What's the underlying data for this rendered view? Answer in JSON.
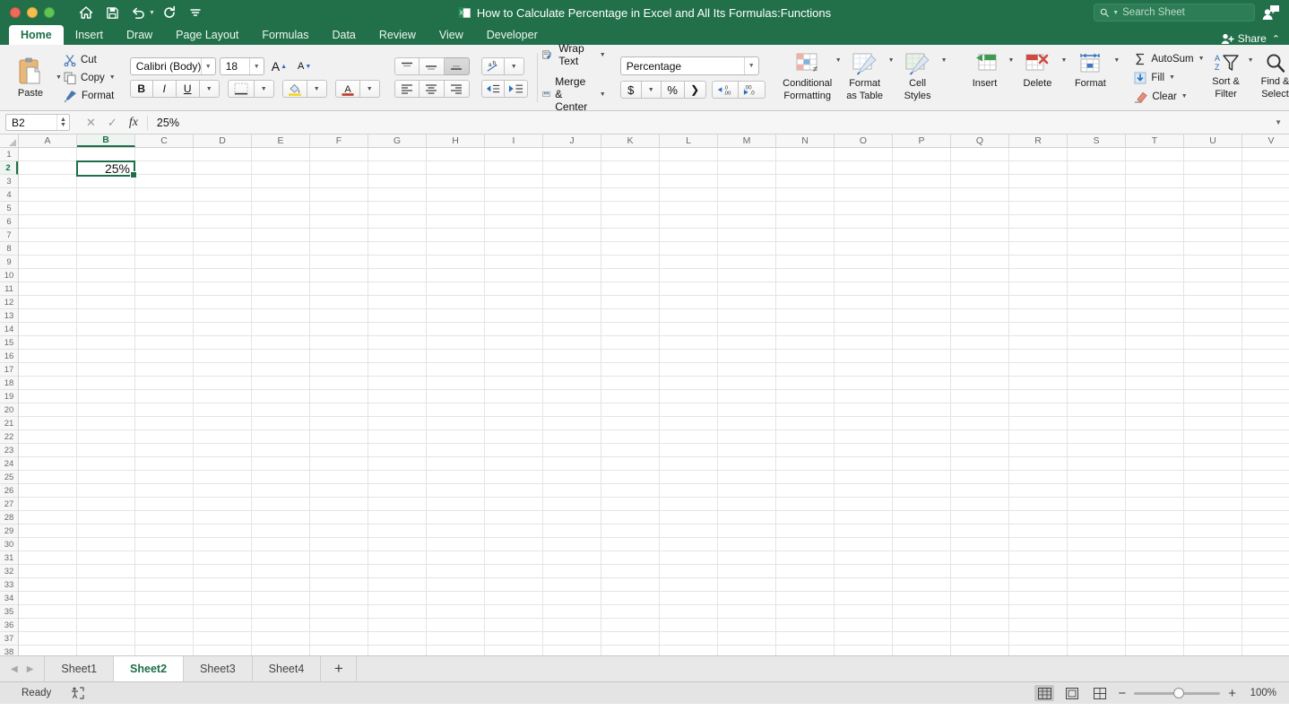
{
  "window": {
    "title": "How to Calculate Percentage in Excel and All Its Formulas:Functions",
    "app_icon": "excel-document-icon"
  },
  "colors": {
    "ribbon_green": "#21704a",
    "accent_green": "#1e6f48",
    "selection_border": "#1e6f48"
  },
  "quick_access": {
    "items": [
      {
        "name": "home-icon",
        "label": "Home"
      },
      {
        "name": "save-icon",
        "label": "Save"
      },
      {
        "name": "undo-icon",
        "label": "Undo"
      },
      {
        "name": "redo-icon",
        "label": "Redo"
      },
      {
        "name": "customize-toolbar-icon",
        "label": "Customize Toolbar"
      }
    ]
  },
  "search": {
    "placeholder": "Search Sheet",
    "value": ""
  },
  "titlebar_right": {
    "comments_icon": "comment-person-icon",
    "share_label": "Share",
    "collapse_icon": "chevron-up-icon"
  },
  "tabs": [
    {
      "label": "Home",
      "active": true
    },
    {
      "label": "Insert",
      "active": false
    },
    {
      "label": "Draw",
      "active": false
    },
    {
      "label": "Page Layout",
      "active": false
    },
    {
      "label": "Formulas",
      "active": false
    },
    {
      "label": "Data",
      "active": false
    },
    {
      "label": "Review",
      "active": false
    },
    {
      "label": "View",
      "active": false
    },
    {
      "label": "Developer",
      "active": false
    }
  ],
  "ribbon": {
    "clipboard": {
      "paste_label": "Paste",
      "cut_label": "Cut",
      "copy_label": "Copy",
      "format_label": "Format"
    },
    "font": {
      "family": "Calibri (Body)",
      "size": "18",
      "grow_label": "A",
      "shrink_label": "A",
      "bold_label": "B",
      "italic_label": "I",
      "underline_label": "U"
    },
    "alignment": {
      "top_align": "align-top",
      "middle_align": "align-middle",
      "bottom_align": "align-bottom",
      "orientation": "text-orientation",
      "align_left": "align-left",
      "align_center": "align-center",
      "align_right": "align-right",
      "decrease_indent": "decrease-indent",
      "increase_indent": "increase-indent",
      "wrap_text_label": "Wrap Text",
      "merge_center_label": "Merge & Center"
    },
    "number": {
      "format": "Percentage",
      "currency_label": "$",
      "percent_label": "%",
      "comma_label": "❯",
      "increase_decimal": ".00",
      "decrease_decimal": ".00"
    },
    "styles": [
      {
        "label_line1": "Conditional",
        "label_line2": "Formatting",
        "icon": "conditional-formatting-icon"
      },
      {
        "label_line1": "Format",
        "label_line2": "as Table",
        "icon": "format-as-table-icon"
      },
      {
        "label_line1": "Cell",
        "label_line2": "Styles",
        "icon": "cell-styles-icon"
      }
    ],
    "cells": [
      {
        "label_line1": "Insert",
        "label_line2": "",
        "icon": "insert-cells-icon"
      },
      {
        "label_line1": "Delete",
        "label_line2": "",
        "icon": "delete-cells-icon"
      },
      {
        "label_line1": "Format",
        "label_line2": "",
        "icon": "format-cells-icon"
      }
    ],
    "editing": {
      "autosum_label": "AutoSum",
      "fill_label": "Fill",
      "clear_label": "Clear",
      "sort_filter_line1": "Sort &",
      "sort_filter_line2": "Filter",
      "find_select_line1": "Find &",
      "find_select_line2": "Select"
    }
  },
  "formula_bar": {
    "name_box": "B2",
    "cancel_icon": "cancel-icon",
    "enter_icon": "checkmark-icon",
    "function_icon": "fx",
    "value": "25%"
  },
  "grid": {
    "columns": [
      "A",
      "B",
      "C",
      "D",
      "E",
      "F",
      "G",
      "H",
      "I",
      "J",
      "K",
      "L",
      "M",
      "N",
      "O",
      "P",
      "Q",
      "R",
      "S",
      "T",
      "U",
      "V"
    ],
    "selected_column": "B",
    "selected_row": 2,
    "rows": [
      1,
      2,
      3,
      4,
      5,
      6,
      7,
      8,
      9,
      10,
      11,
      12,
      13,
      14,
      15,
      16,
      17,
      18,
      19,
      20,
      21,
      22,
      23,
      24,
      25,
      26,
      27,
      28,
      29,
      30,
      31,
      32,
      33,
      34,
      35,
      36,
      37,
      38
    ],
    "active_cell": {
      "ref": "B2",
      "value": "25%"
    }
  },
  "sheet_tabs": {
    "prev_icon": "triangle-left-icon",
    "next_icon": "triangle-right-icon",
    "sheets": [
      {
        "label": "Sheet1",
        "active": false
      },
      {
        "label": "Sheet2",
        "active": true
      },
      {
        "label": "Sheet3",
        "active": false
      },
      {
        "label": "Sheet4",
        "active": false
      }
    ],
    "add_label": "+"
  },
  "status_bar": {
    "status": "Ready",
    "accessibility_icon": "accessibility-checker-icon",
    "views": [
      {
        "name": "normal-view-button",
        "active": true
      },
      {
        "name": "page-layout-view-button",
        "active": false
      },
      {
        "name": "page-break-view-button",
        "active": false
      }
    ],
    "zoom_out_label": "−",
    "zoom_in_label": "+",
    "zoom_level": "100%"
  }
}
